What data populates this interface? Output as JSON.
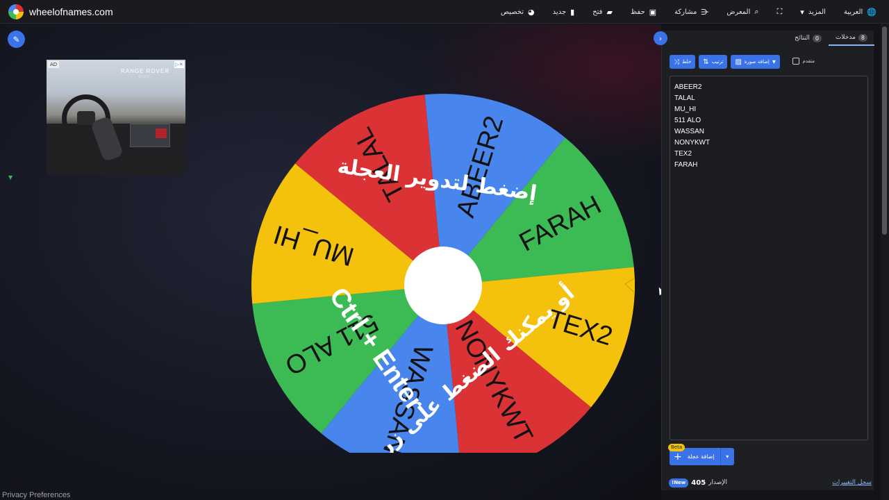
{
  "site": {
    "title": "wheelofnames.com"
  },
  "menu": {
    "language": "العربية",
    "more": "المزيد",
    "gallery": "المعرض",
    "share": "مشاركة",
    "save": "حفظ",
    "open": "فتح",
    "new": "جديد",
    "customize": "تخصيص"
  },
  "ad": {
    "label": "AD",
    "brand": "RANGE ROVER",
    "sub": "SPORT"
  },
  "wheel": {
    "slices": [
      {
        "name": "ABEER2",
        "color": "#4885ed"
      },
      {
        "name": "FARAH",
        "color": "#3cba54"
      },
      {
        "name": "TEX2",
        "color": "#f4c20d"
      },
      {
        "name": "NONYKWT",
        "color": "#db3236"
      },
      {
        "name": "WASSAN",
        "color": "#4885ed"
      },
      {
        "name": "511 ALO",
        "color": "#3cba54"
      },
      {
        "name": "MU_HI",
        "color": "#f4c20d"
      },
      {
        "name": "TALAL",
        "color": "#db3236"
      }
    ],
    "overlay_top": "إضغط لتدوير العجلة",
    "overlay_bottom": "أو يمكنك الضغط على زر",
    "overlay_keys": "Ctrl + Enter"
  },
  "panel": {
    "tab_entries": "مدخلات",
    "tab_entries_count": "8",
    "tab_results": "النتائج",
    "tab_results_count": "0",
    "shuffle": "خلط",
    "sort": "ترتيب",
    "add_image": "إضافة صورة",
    "advanced": "متقدم",
    "entries": [
      "ABEER2",
      "TALAL",
      "MU_HI",
      "511 ALO",
      "WASSAN",
      "NONYKWT",
      "TEX2",
      "FARAH"
    ],
    "add_wheel": "إضافة عجلة",
    "beta": "Beta",
    "version_label": "الإصدار",
    "version_number": "405",
    "new_badge": "New!",
    "changelog": "سجل التغييرات"
  },
  "privacy": "Privacy Preferences"
}
